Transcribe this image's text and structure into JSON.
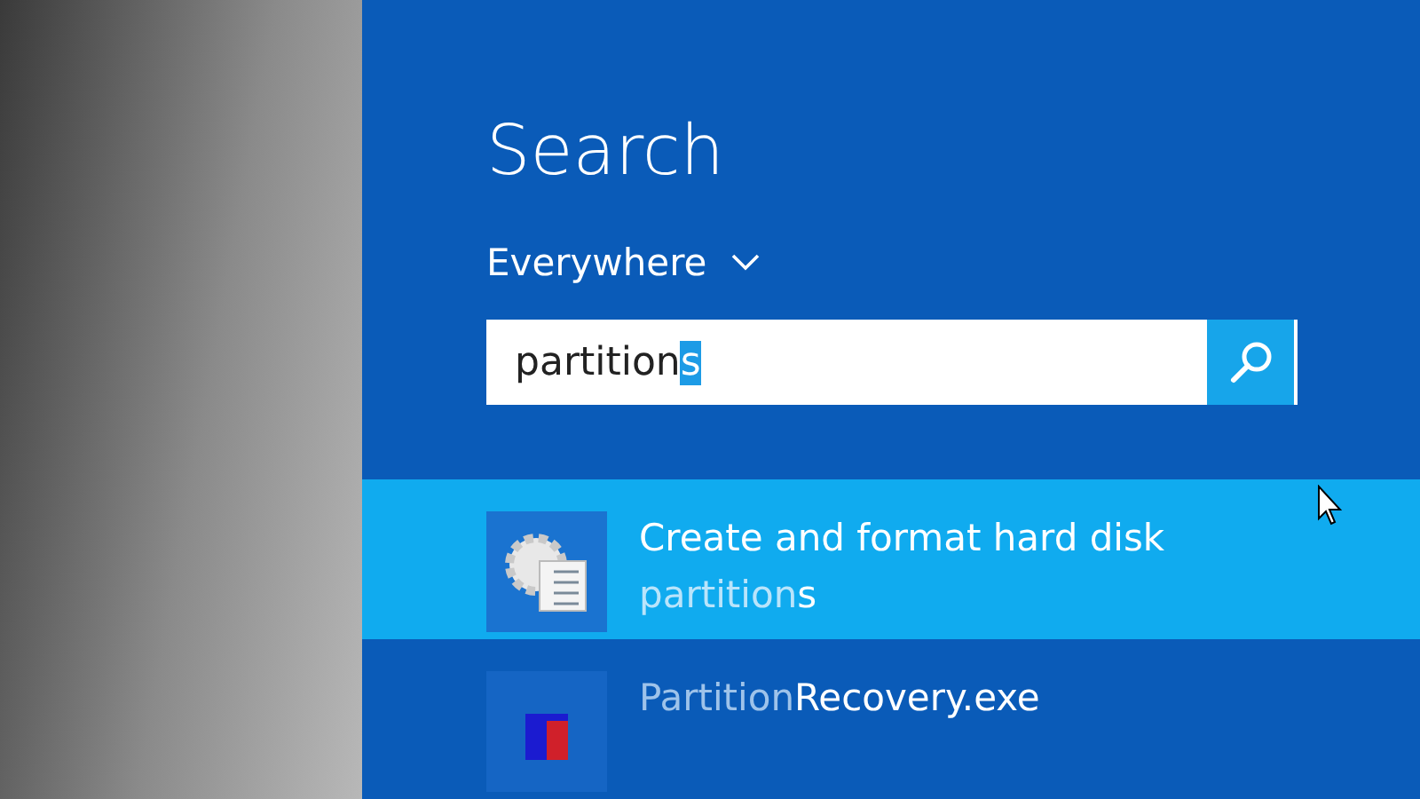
{
  "title": "Search",
  "scope": {
    "label": "Everywhere",
    "expanded": false
  },
  "search": {
    "value": "partition",
    "selected_text": "s"
  },
  "results": [
    {
      "kind": "settings",
      "selected": true,
      "title": "Create and format hard disk",
      "match": "partition",
      "rest": "s"
    },
    {
      "kind": "app",
      "selected": false,
      "match": "Partition",
      "rest": "Recovery.exe"
    }
  ]
}
